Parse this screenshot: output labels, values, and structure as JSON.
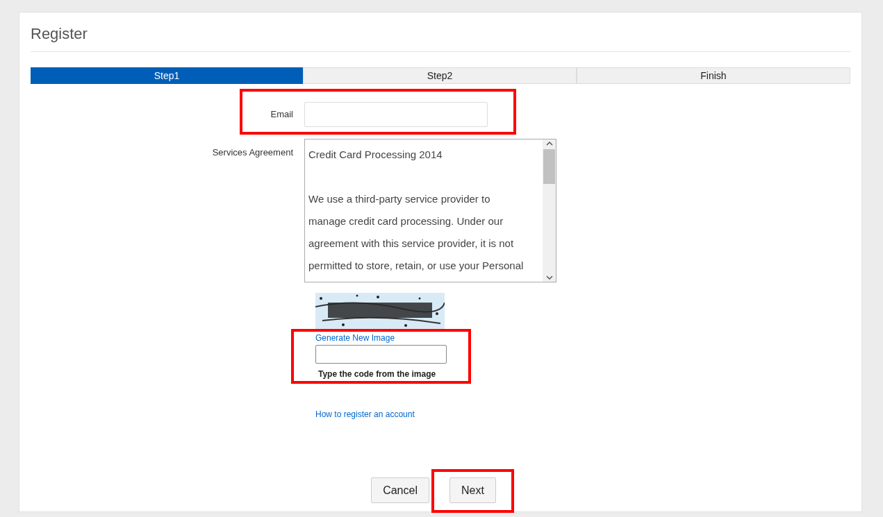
{
  "title": "Register",
  "steps": [
    {
      "label": "Step1",
      "selected": true
    },
    {
      "label": "Step2",
      "selected": false
    },
    {
      "label": "Finish",
      "selected": false
    }
  ],
  "email": {
    "label": "Email",
    "highlighted": true
  },
  "agreement": {
    "label": "Services Agreement",
    "heading": "Credit Card Processing 2014",
    "lines": [
      "We use a third-party service provider to",
      "manage credit card processing. Under our",
      "agreement with this service provider, it is not",
      "permitted to store, retain, or use your Personal"
    ]
  },
  "captcha": {
    "kind": "picture",
    "new_image_link": "Generate New Image",
    "hint": "Type the code from the image",
    "highlighted": true
  },
  "help_link": "How to register an account",
  "buttons": [
    {
      "label": "Cancel",
      "highlighted": false
    },
    {
      "label": "Next",
      "highlighted": true
    }
  ]
}
